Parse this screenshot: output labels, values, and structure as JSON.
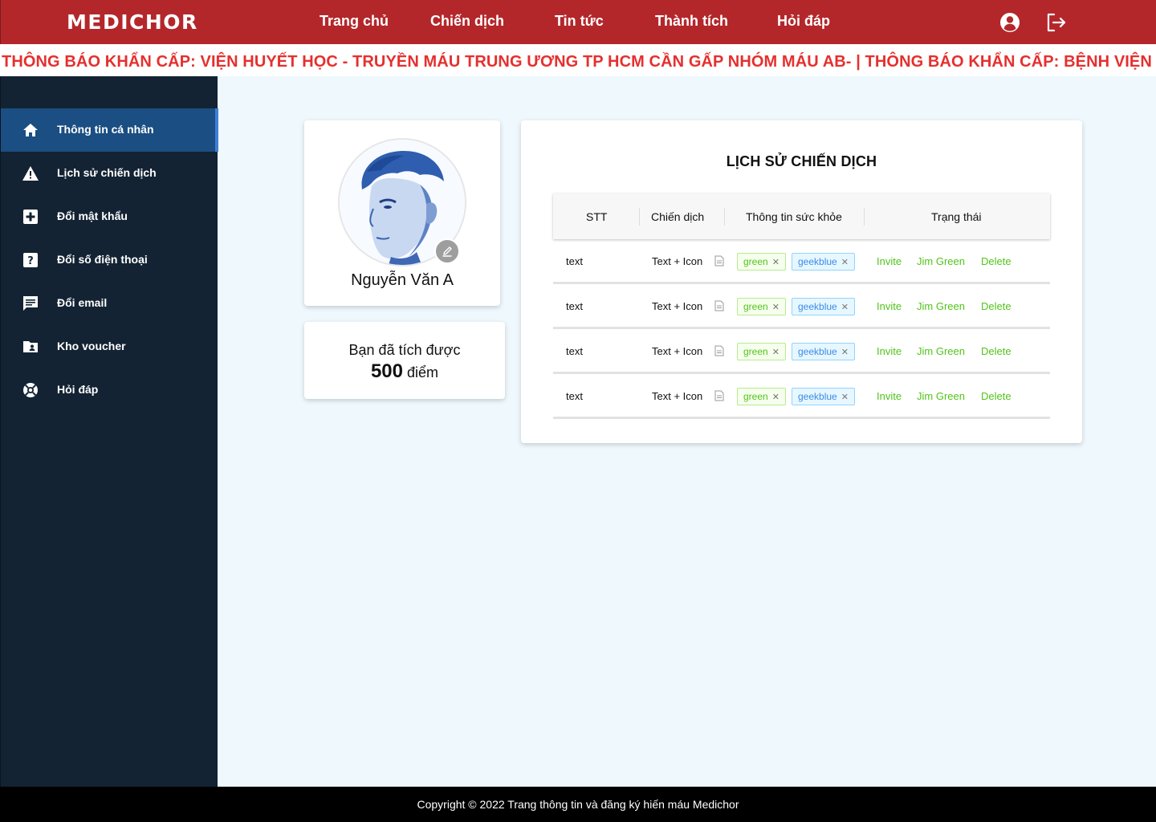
{
  "header": {
    "logo": "MEDICHOR",
    "nav": [
      {
        "label": "Trang chủ"
      },
      {
        "label": "Chiến dịch"
      },
      {
        "label": "Tin tức"
      },
      {
        "label": "Thành tích"
      },
      {
        "label": "Hỏi đáp"
      }
    ],
    "icons": [
      "user-circle-icon",
      "logout-icon"
    ]
  },
  "marquee": {
    "text": "THÔNG BÁO KHẨN CẤP: VIỆN HUYẾT HỌC - TRUYỀN MÁU TRUNG ƯƠNG TP HCM CẦN GẤP NHÓM MÁU AB-  |  THÔNG BÁO KHẨN CẤP: BỆNH VIỆN"
  },
  "sidebar": {
    "items": [
      {
        "label": "Thông tin cá nhân",
        "icon": "home-icon",
        "active": true
      },
      {
        "label": "Lịch sử chiến dịch",
        "icon": "warning-icon",
        "active": false
      },
      {
        "label": "Đổi mật khẩu",
        "icon": "plus-box-icon",
        "active": false
      },
      {
        "label": "Đổi số điện thoại",
        "icon": "question-box-icon",
        "active": false
      },
      {
        "label": "Đổi email",
        "icon": "message-icon",
        "active": false
      },
      {
        "label": "Kho voucher",
        "icon": "folder-user-icon",
        "active": false
      },
      {
        "label": "Hỏi đáp",
        "icon": "lifebuoy-icon",
        "active": false
      }
    ]
  },
  "profile": {
    "name": "Nguyễn Văn A"
  },
  "points": {
    "line1": "Bạn đã tích được",
    "value": "500",
    "unit": "điểm"
  },
  "history": {
    "title": "LỊCH SỬ CHIẾN DỊCH",
    "columns": [
      "STT",
      "Chiến dịch",
      "Thông tin sức khỏe",
      "Trạng thái"
    ],
    "rows": [
      {
        "stt": "text",
        "campaign": "Text + Icon",
        "tags": [
          "green",
          "geekblue"
        ],
        "actions": [
          "Invite",
          "Jim Green",
          "Delete"
        ]
      },
      {
        "stt": "text",
        "campaign": "Text + Icon",
        "tags": [
          "green",
          "geekblue"
        ],
        "actions": [
          "Invite",
          "Jim Green",
          "Delete"
        ]
      },
      {
        "stt": "text",
        "campaign": "Text + Icon",
        "tags": [
          "green",
          "geekblue"
        ],
        "actions": [
          "Invite",
          "Jim Green",
          "Delete"
        ]
      },
      {
        "stt": "text",
        "campaign": "Text + Icon",
        "tags": [
          "green",
          "geekblue"
        ],
        "actions": [
          "Invite",
          "Jim Green",
          "Delete"
        ]
      }
    ]
  },
  "footer": {
    "text": "Copyright © 2022 Trang thông tin và đăng ký hiến máu Medichor"
  },
  "colors": {
    "header": "#b3272b",
    "sidebar": "#132333",
    "sidebar_active": "#1b4e82",
    "marquee_text": "#e5302e",
    "page_bg": "#eef8fd",
    "action_green": "#52c41a"
  }
}
